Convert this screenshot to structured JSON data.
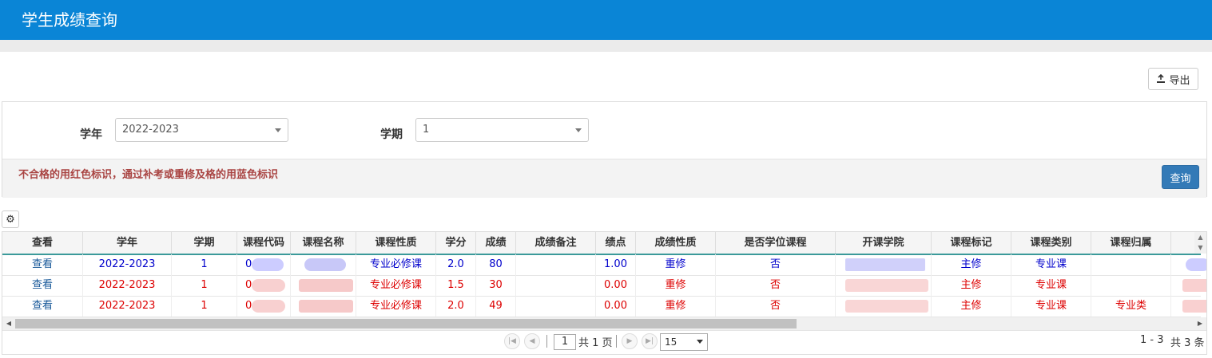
{
  "header": {
    "title": "学生成绩查询"
  },
  "toolbar": {
    "export_label": "导出"
  },
  "filters": {
    "year_label": "学年",
    "year_value": "2022-2023",
    "term_label": "学期",
    "term_value": "1",
    "notice": "不合格的用红色标识，通过补考或重修及格的用蓝色标识",
    "query_label": "查询"
  },
  "table": {
    "columns": [
      "查看",
      "学年",
      "学期",
      "课程代码",
      "课程名称",
      "课程性质",
      "学分",
      "成绩",
      "成绩备注",
      "绩点",
      "成绩性质",
      "是否学位课程",
      "开课学院",
      "课程标记",
      "课程类别",
      "课程归属"
    ],
    "rows": [
      {
        "status": "blue",
        "view": "查看",
        "year": "2022-2023",
        "term": "1",
        "code": "0",
        "name": "",
        "nature": "专业必修课",
        "credit": "2.0",
        "score": "80",
        "remark": "",
        "gpa": "1.00",
        "score_nature": "重修",
        "degree": "否",
        "college": "",
        "mark": "主修",
        "category": "专业课",
        "belong": ""
      },
      {
        "status": "red",
        "view": "查看",
        "year": "2022-2023",
        "term": "1",
        "code": "0",
        "name": "",
        "nature": "专业必修课",
        "credit": "1.5",
        "score": "30",
        "remark": "",
        "gpa": "0.00",
        "score_nature": "重修",
        "degree": "否",
        "college": "",
        "mark": "主修",
        "category": "专业课",
        "belong": ""
      },
      {
        "status": "red",
        "view": "查看",
        "year": "2022-2023",
        "term": "1",
        "code": "0",
        "name": "",
        "nature": "专业必修课",
        "credit": "2.0",
        "score": "49",
        "remark": "",
        "gpa": "0.00",
        "score_nature": "重修",
        "degree": "否",
        "college": "",
        "mark": "主修",
        "category": "专业课",
        "belong": "专业类"
      }
    ]
  },
  "pager": {
    "current_page": "1",
    "total_pages_text": "共 1 页",
    "page_size": "15",
    "range_text": "1 - 3",
    "total_text": "共 3 条"
  },
  "colors": {
    "header": "#0a85d6",
    "pass_retake": "#0000cc",
    "fail": "#dd0000",
    "primary_button": "#337ab7"
  }
}
